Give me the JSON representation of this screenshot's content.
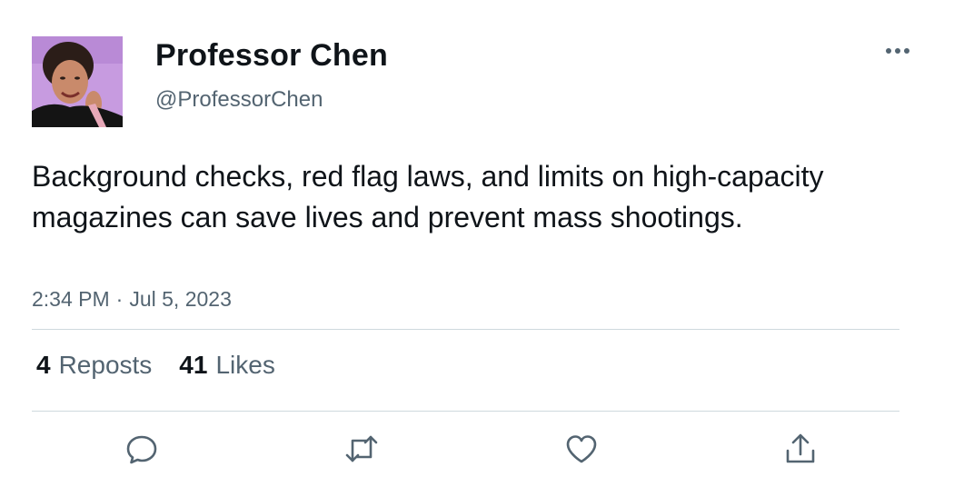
{
  "author": {
    "display_name": "Professor Chen",
    "handle": "@ProfessorChen",
    "avatar": "avatar-photo"
  },
  "tweet": {
    "text": "Background checks, red flag laws, and limits on high-capacity magazines can save lives and prevent mass shootings.",
    "time": "2:34 PM",
    "separator": "·",
    "date": "Jul 5, 2023"
  },
  "stats": {
    "reposts_count": "4",
    "reposts_label": "Reposts",
    "likes_count": "41",
    "likes_label": "Likes"
  },
  "icons": {
    "more": "more-icon",
    "reply": "reply-icon",
    "repost": "repost-icon",
    "like": "heart-icon",
    "share": "share-icon"
  },
  "colors": {
    "text_primary": "#0f1419",
    "text_secondary": "#536471",
    "divider": "#cfd9de"
  }
}
